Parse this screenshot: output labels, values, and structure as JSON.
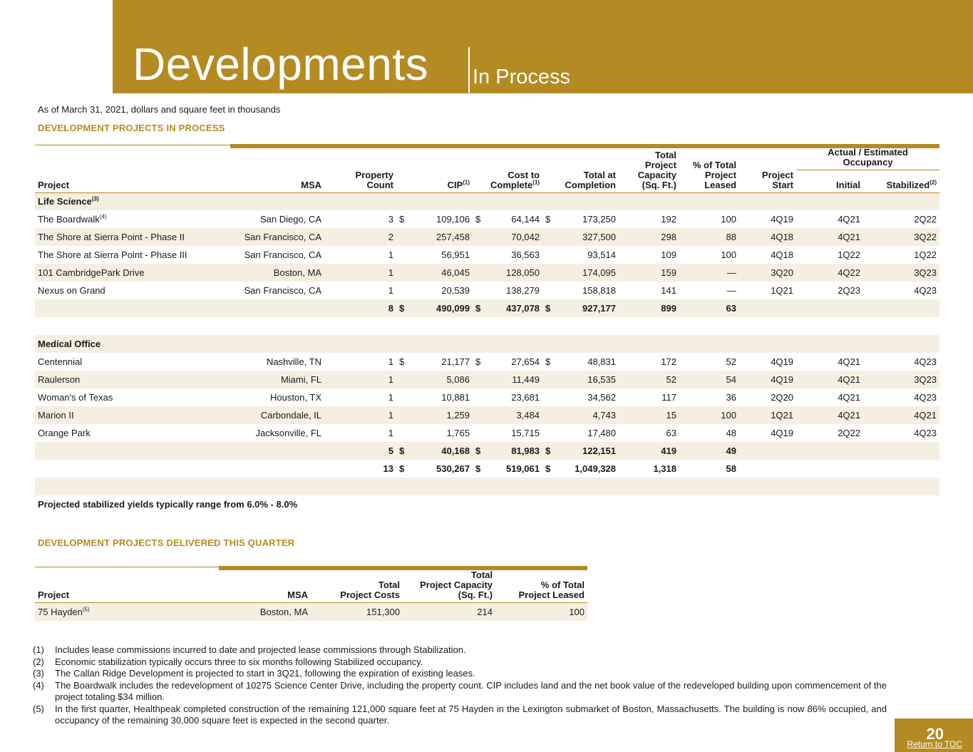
{
  "header": {
    "title": "Developments",
    "subtitle": "In Process"
  },
  "as_of": "As of March 31, 2021, dollars and square feet in thousands",
  "in_process": {
    "heading": "DEVELOPMENT PROJECTS IN PROCESS",
    "columns": {
      "project": "Project",
      "msa": "MSA",
      "property_count": [
        "Property",
        "Count"
      ],
      "cip": "CIP",
      "cip_note": "(1)",
      "cost_to_complete": [
        "Cost to",
        "Complete"
      ],
      "cost_note": "(1)",
      "total_at_completion": [
        "Total at",
        "Completion"
      ],
      "capacity": [
        "Total",
        "Project",
        "Capacity",
        "(Sq. Ft.)"
      ],
      "leased": [
        "% of Total",
        "Project",
        "Leased"
      ],
      "start": [
        "Project",
        "Start"
      ],
      "occupancy_group": [
        "Actual / Estimated",
        "Occupancy"
      ],
      "initial": "Initial",
      "stabilized": "Stabilized",
      "stabilized_note": "(2)"
    },
    "life_science": {
      "label": "Life Science",
      "note": "(3)",
      "rows": [
        {
          "project": "The Boardwalk",
          "note": "(4)",
          "msa": "San Diego, CA",
          "count": "3",
          "cip_sym": "$",
          "cip": "109,106",
          "ctc_sym": "$",
          "ctc": "64,144",
          "tot_sym": "$",
          "total": "173,250",
          "capacity": "192",
          "leased": "100",
          "start": "4Q19",
          "initial": "4Q21",
          "stabilized": "2Q22"
        },
        {
          "project": "The Shore at Sierra Point - Phase II",
          "note": "",
          "msa": "San Francisco, CA",
          "count": "2",
          "cip_sym": "",
          "cip": "257,458",
          "ctc_sym": "",
          "ctc": "70,042",
          "tot_sym": "",
          "total": "327,500",
          "capacity": "298",
          "leased": "88",
          "start": "4Q18",
          "initial": "4Q21",
          "stabilized": "3Q22"
        },
        {
          "project": "The Shore at Sierra Point - Phase III",
          "note": "",
          "msa": "San Francisco, CA",
          "count": "1",
          "cip_sym": "",
          "cip": "56,951",
          "ctc_sym": "",
          "ctc": "36,563",
          "tot_sym": "",
          "total": "93,514",
          "capacity": "109",
          "leased": "100",
          "start": "4Q18",
          "initial": "1Q22",
          "stabilized": "1Q22"
        },
        {
          "project": "101 CambridgePark Drive",
          "note": "",
          "msa": "Boston, MA",
          "count": "1",
          "cip_sym": "",
          "cip": "46,045",
          "ctc_sym": "",
          "ctc": "128,050",
          "tot_sym": "",
          "total": "174,095",
          "capacity": "159",
          "leased": "—",
          "start": "3Q20",
          "initial": "4Q22",
          "stabilized": "3Q23"
        },
        {
          "project": "Nexus on Grand",
          "note": "",
          "msa": "San Francisco, CA",
          "count": "1",
          "cip_sym": "",
          "cip": "20,539",
          "ctc_sym": "",
          "ctc": "138,279",
          "tot_sym": "",
          "total": "158,818",
          "capacity": "141",
          "leased": "—",
          "start": "1Q21",
          "initial": "2Q23",
          "stabilized": "4Q23"
        }
      ],
      "subtotal": {
        "count": "8",
        "cip_sym": "$",
        "cip": "490,099",
        "ctc_sym": "$",
        "ctc": "437,078",
        "tot_sym": "$",
        "total": "927,177",
        "capacity": "899",
        "leased": "63"
      }
    },
    "medical_office": {
      "label": "Medical Office",
      "rows": [
        {
          "project": "Centennial",
          "msa": "Nashville, TN",
          "count": "1",
          "cip_sym": "$",
          "cip": "21,177",
          "ctc_sym": "$",
          "ctc": "27,654",
          "tot_sym": "$",
          "total": "48,831",
          "capacity": "172",
          "leased": "52",
          "start": "4Q19",
          "initial": "4Q21",
          "stabilized": "4Q23"
        },
        {
          "project": "Raulerson",
          "msa": "Miami, FL",
          "count": "1",
          "cip_sym": "",
          "cip": "5,086",
          "ctc_sym": "",
          "ctc": "11,449",
          "tot_sym": "",
          "total": "16,535",
          "capacity": "52",
          "leased": "54",
          "start": "4Q19",
          "initial": "4Q21",
          "stabilized": "3Q23"
        },
        {
          "project": "Woman's of Texas",
          "msa": "Houston, TX",
          "count": "1",
          "cip_sym": "",
          "cip": "10,881",
          "ctc_sym": "",
          "ctc": "23,681",
          "tot_sym": "",
          "total": "34,562",
          "capacity": "117",
          "leased": "36",
          "start": "2Q20",
          "initial": "4Q21",
          "stabilized": "4Q23"
        },
        {
          "project": "Marion II",
          "msa": "Carbondale, IL",
          "count": "1",
          "cip_sym": "",
          "cip": "1,259",
          "ctc_sym": "",
          "ctc": "3,484",
          "tot_sym": "",
          "total": "4,743",
          "capacity": "15",
          "leased": "100",
          "start": "1Q21",
          "initial": "4Q21",
          "stabilized": "4Q21"
        },
        {
          "project": "Orange Park",
          "msa": "Jacksonville, FL",
          "count": "1",
          "cip_sym": "",
          "cip": "1,765",
          "ctc_sym": "",
          "ctc": "15,715",
          "tot_sym": "",
          "total": "17,480",
          "capacity": "63",
          "leased": "48",
          "start": "4Q19",
          "initial": "2Q22",
          "stabilized": "4Q23"
        }
      ],
      "subtotal": {
        "count": "5",
        "cip_sym": "$",
        "cip": "40,168",
        "ctc_sym": "$",
        "ctc": "81,983",
        "tot_sym": "$",
        "total": "122,151",
        "capacity": "419",
        "leased": "49"
      }
    },
    "grand_total": {
      "count": "13",
      "cip_sym": "$",
      "cip": "530,267",
      "ctc_sym": "$",
      "ctc": "519,061",
      "tot_sym": "$",
      "total": "1,049,328",
      "capacity": "1,318",
      "leased": "58"
    },
    "yield_note": "Projected stabilized yields typically range from 6.0% - 8.0%"
  },
  "delivered": {
    "heading": "DEVELOPMENT PROJECTS DELIVERED THIS QUARTER",
    "columns": {
      "project": "Project",
      "msa": "MSA",
      "costs": [
        "Total",
        "Project Costs"
      ],
      "capacity": [
        "Total",
        "Project Capacity",
        "(Sq. Ft.)"
      ],
      "leased": [
        "% of Total",
        "Project Leased"
      ]
    },
    "rows": [
      {
        "project": "75 Hayden",
        "note": "(5)",
        "msa": "Boston, MA",
        "costs": "151,300",
        "capacity": "214",
        "leased": "100"
      }
    ]
  },
  "footnotes": [
    {
      "num": "(1)",
      "text": "Includes lease commissions incurred to date and projected lease commissions through Stabilization."
    },
    {
      "num": "(2)",
      "text": "Economic stabilization typically occurs three to six months following Stabilized occupancy."
    },
    {
      "num": "(3)",
      "text": "The Callan Ridge Development is projected to start in 3Q21, following the expiration of existing leases."
    },
    {
      "num": "(4)",
      "text": "The Boardwalk includes the redevelopment of 10275 Science Center Drive, including the property count. CIP includes land and the net book value of the redeveloped building upon commencement of the project totaling $34 million."
    },
    {
      "num": "(5)",
      "text": "In the first quarter, Healthpeak completed construction of the remaining 121,000 square feet at 75 Hayden in the Lexington submarket of Boston, Massachusetts. The building is now 86% occupied, and occupancy of the remaining 30,000 square feet is expected in the second quarter."
    }
  ],
  "page": {
    "number": "20",
    "toc_link": "Return to TOC"
  },
  "colors": {
    "accent": "#b48b22",
    "row_shade": "#f4efe1"
  }
}
